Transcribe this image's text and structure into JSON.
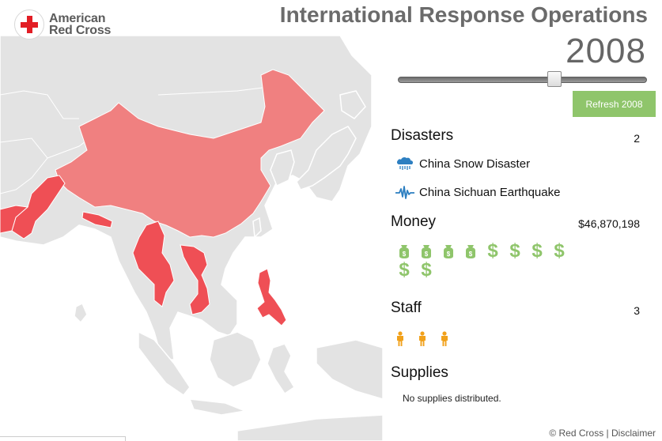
{
  "logo": {
    "line1": "American",
    "line2": "Red Cross",
    "cross_color": "#e21d24"
  },
  "header": {
    "title": "International Response Operations",
    "year": "2008"
  },
  "slider": {
    "value_fraction": 0.63
  },
  "refresh": {
    "label": "Refresh 2008",
    "color": "#8fc56b"
  },
  "disasters": {
    "heading": "Disasters",
    "count": "2",
    "items": [
      {
        "label": "China Snow Disaster",
        "icon": "snow-cloud-icon"
      },
      {
        "label": "China Sichuan Earthquake",
        "icon": "seismograph-icon"
      }
    ]
  },
  "money": {
    "heading": "Money",
    "total": "$46,870,198",
    "bag_icons": 4,
    "dollar_icons": 6,
    "dollar_glyph": "$"
  },
  "staff": {
    "heading": "Staff",
    "count": "3",
    "person_icons": 3
  },
  "supplies": {
    "heading": "Supplies",
    "message": "No supplies distributed."
  },
  "footer": {
    "copyright": "© Red Cross",
    "separator": " | ",
    "disclaimer": "Disclaimer"
  },
  "colors": {
    "highlight_country": "#f08080",
    "highlight_country_strong": "#ef4f55",
    "land": "#e3e3e3",
    "border": "#ffffff",
    "accent_green": "#8fc56b",
    "staff_orange": "#f1a11b"
  }
}
